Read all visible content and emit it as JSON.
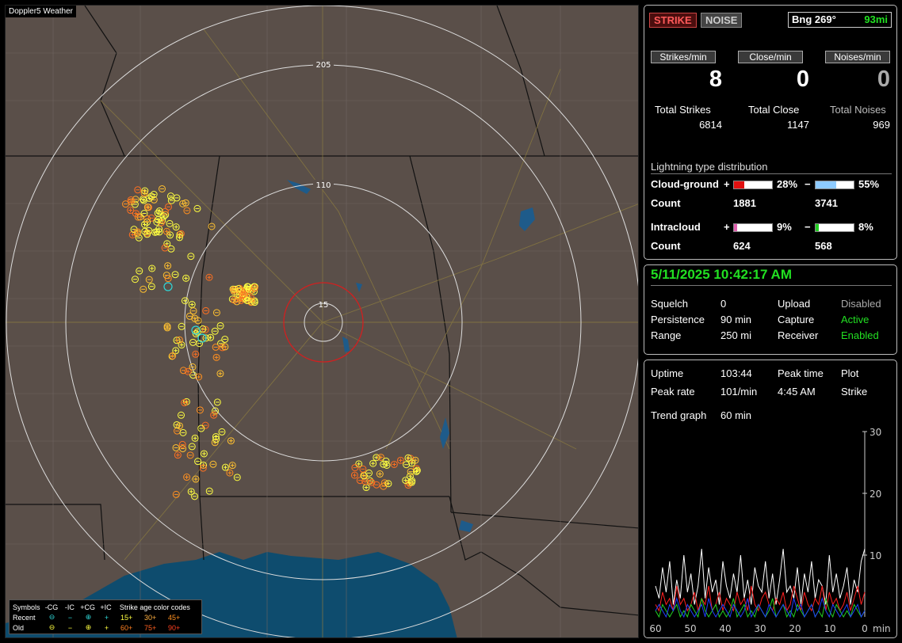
{
  "map": {
    "title": "Doppler5 Weather",
    "ring_labels": [
      "205",
      "110",
      "15"
    ]
  },
  "legend": {
    "symbols_label": "Symbols",
    "cols": [
      "-CG",
      "-IC",
      "+CG",
      "+IC"
    ],
    "recent_label": "Recent",
    "old_label": "Old",
    "age_title": "Strike age color codes",
    "recent_ages": [
      "15+",
      "30+",
      "45+"
    ],
    "old_ages": [
      "60+",
      "75+",
      "90+"
    ],
    "recent_symbols": [
      "⊖",
      "−",
      "⊕",
      "+"
    ],
    "old_symbols": [
      "⊖",
      "−",
      "⊕",
      "+"
    ]
  },
  "status": {
    "strike_label": "STRIKE",
    "noise_label": "NOISE",
    "bearing": "Bng 269°",
    "distance": "93mi"
  },
  "rates": {
    "strikes_label": "Strikes/min",
    "close_label": "Close/min",
    "noises_label": "Noises/min",
    "strikes": "8",
    "close": "0",
    "noises": "0"
  },
  "totals": {
    "strikes_label": "Total Strikes",
    "close_label": "Total Close",
    "noises_label": "Total Noises",
    "strikes": "6814",
    "close": "1147",
    "noises": "969"
  },
  "distribution": {
    "title": "Lightning type distribution",
    "cg_label": "Cloud-ground",
    "ic_label": "Intracloud",
    "count_label": "Count",
    "plus": "+",
    "minus": "−",
    "cg_pos_pct": "28%",
    "cg_neg_pct": "55%",
    "cg_pos_count": "1881",
    "cg_neg_count": "3741",
    "ic_pos_pct": "9%",
    "ic_neg_pct": "8%",
    "ic_pos_count": "624",
    "ic_neg_count": "568",
    "cg_pos_frac": 0.28,
    "cg_neg_frac": 0.55,
    "ic_pos_frac": 0.09,
    "ic_neg_frac": 0.08,
    "colors": {
      "cg_pos": "#e01010",
      "cg_neg": "#8ecbff",
      "ic_pos": "#e060b0",
      "ic_neg": "#22d022"
    }
  },
  "settings": {
    "datetime": "5/11/2025 10:42:17 AM",
    "squelch_label": "Squelch",
    "squelch": "0",
    "persistence_label": "Persistence",
    "persistence": "90 min",
    "range_label": "Range",
    "range": "250 mi",
    "upload_label": "Upload",
    "upload": "Disabled",
    "capture_label": "Capture",
    "capture": "Active",
    "receiver_label": "Receiver",
    "receiver": "Enabled"
  },
  "stats": {
    "uptime_label": "Uptime",
    "uptime": "103:44",
    "peak_time_label": "Peak time",
    "peak_time": "4:45 AM",
    "plot_label": "Plot",
    "plot": "Strike",
    "peak_rate_label": "Peak rate",
    "peak_rate": "101/min",
    "trend_label": "Trend graph",
    "trend_window": "60 min"
  },
  "chart_data": {
    "type": "line",
    "title": "",
    "xlabel": "min",
    "ylabel": "",
    "x_ticks": [
      "60",
      "50",
      "40",
      "30",
      "20",
      "10",
      "0"
    ],
    "y_ticks": [
      "30",
      "20",
      "10"
    ],
    "xlim": [
      60,
      0
    ],
    "ylim": [
      0,
      30
    ],
    "series": [
      {
        "color": "#ffffff",
        "values": [
          5,
          3,
          8,
          4,
          9,
          2,
          6,
          3,
          10,
          4,
          7,
          2,
          5,
          11,
          3,
          8,
          4,
          6,
          2,
          9,
          5,
          3,
          7,
          4,
          10,
          3,
          6,
          2,
          8,
          5,
          4,
          9,
          3,
          7,
          2,
          6,
          11,
          4,
          5,
          3,
          8,
          2,
          7,
          4,
          9,
          3,
          6,
          5,
          2,
          10,
          4,
          7,
          3,
          5,
          8,
          2,
          6,
          4,
          9,
          11
        ]
      },
      {
        "color": "#ff2020",
        "values": [
          2,
          1,
          4,
          2,
          3,
          1,
          5,
          2,
          3,
          1,
          2,
          4,
          1,
          3,
          2,
          5,
          1,
          2,
          4,
          1,
          3,
          2,
          1,
          4,
          2,
          3,
          1,
          5,
          2,
          1,
          3,
          4,
          2,
          1,
          3,
          2,
          4,
          1,
          2,
          5,
          3,
          1,
          4,
          2,
          1,
          3,
          2,
          5,
          1,
          4,
          2,
          3,
          1,
          2,
          4,
          1,
          3,
          5,
          2,
          4
        ]
      },
      {
        "color": "#22d022",
        "values": [
          1,
          0,
          2,
          1,
          0,
          1,
          2,
          0,
          1,
          0,
          2,
          1,
          0,
          3,
          1,
          0,
          1,
          2,
          0,
          1,
          0,
          1,
          3,
          0,
          1,
          2,
          0,
          1,
          0,
          2,
          1,
          0,
          1,
          3,
          0,
          1,
          2,
          0,
          1,
          0,
          2,
          1,
          0,
          1,
          2,
          0,
          1,
          0,
          3,
          1,
          0,
          2,
          1,
          0,
          1,
          0,
          2,
          1,
          0,
          1
        ]
      },
      {
        "color": "#2040ff",
        "values": [
          1,
          2,
          1,
          0,
          2,
          1,
          3,
          1,
          0,
          2,
          1,
          0,
          1,
          2,
          0,
          3,
          1,
          0,
          1,
          2,
          1,
          0,
          2,
          1,
          0,
          1,
          3,
          0,
          1,
          2,
          1,
          0,
          2,
          1,
          0,
          1,
          2,
          1,
          0,
          3,
          1,
          2,
          0,
          1,
          2,
          0,
          1,
          3,
          1,
          0,
          2,
          1,
          0,
          1,
          2,
          0,
          1,
          2,
          0,
          1
        ]
      }
    ]
  }
}
